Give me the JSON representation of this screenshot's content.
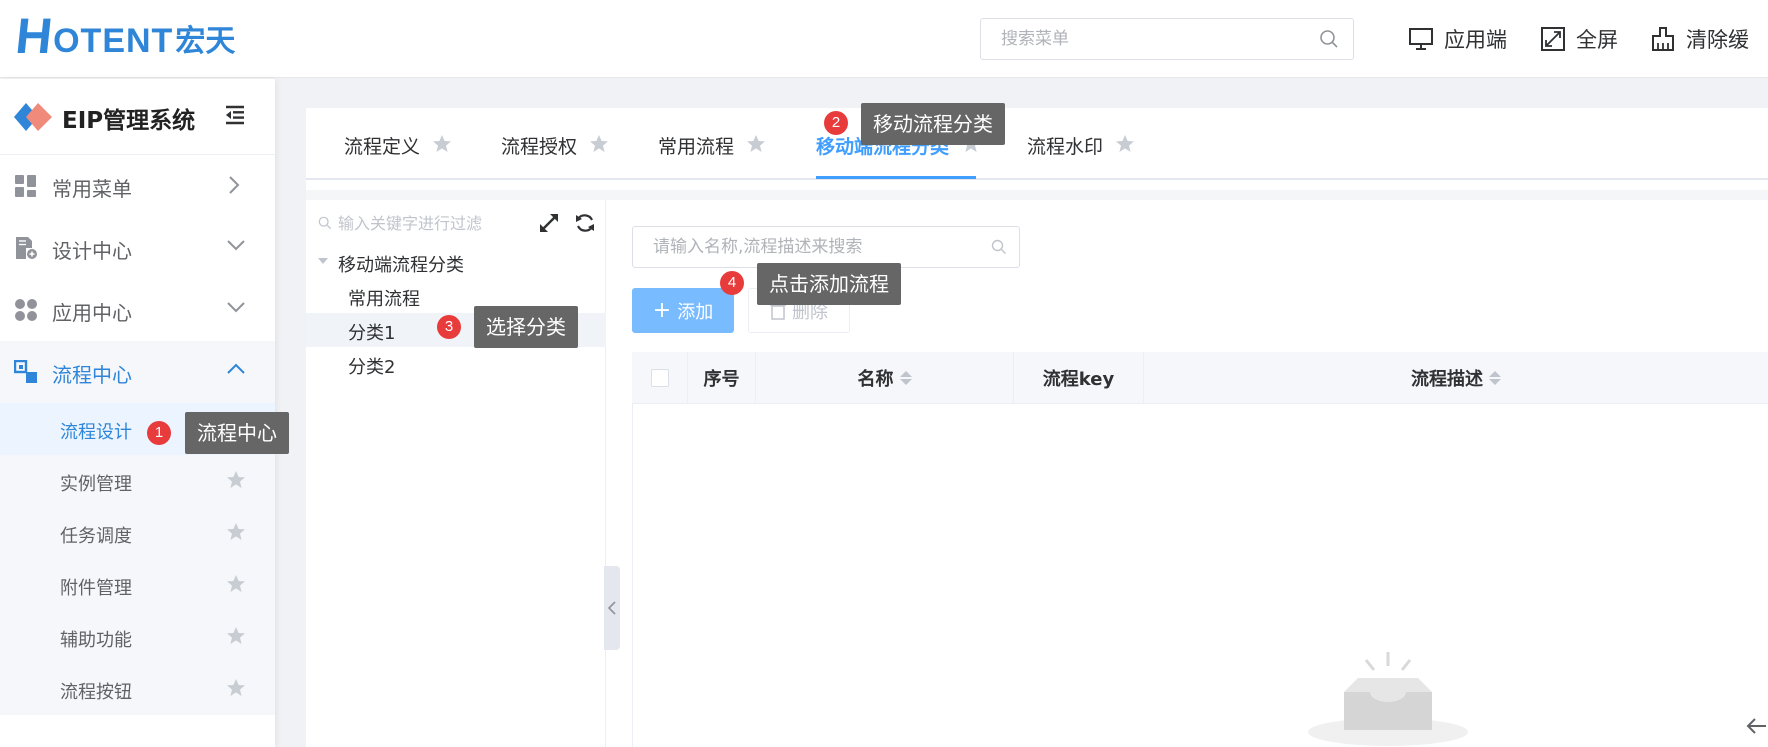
{
  "header": {
    "logo_h": "H",
    "logo_rest": "OTENT",
    "logo_cn": "宏天",
    "search_placeholder": "搜索菜单",
    "app_end_label": "应用端",
    "fullscreen_label": "全屏",
    "clear_cache_label": "清除缓"
  },
  "sidebar": {
    "system_name": "EIP管理系统",
    "menus": [
      {
        "label": "常用菜单",
        "icon": "grid-icon"
      },
      {
        "label": "设计中心",
        "icon": "document-settings-icon"
      },
      {
        "label": "应用中心",
        "icon": "apps-icon"
      },
      {
        "label": "流程中心",
        "icon": "flow-icon"
      }
    ],
    "sub_items": [
      {
        "label": "流程设计"
      },
      {
        "label": "实例管理"
      },
      {
        "label": "任务调度"
      },
      {
        "label": "附件管理"
      },
      {
        "label": "辅助功能"
      },
      {
        "label": "流程按钮"
      }
    ]
  },
  "tabs": [
    {
      "label": "流程定义"
    },
    {
      "label": "流程授权"
    },
    {
      "label": "常用流程"
    },
    {
      "label": "移动端流程分类"
    },
    {
      "label": "流程水印"
    }
  ],
  "tree": {
    "filter_placeholder": "输入关键字进行过滤",
    "root": "移动端流程分类",
    "children": [
      "常用流程",
      "分类1",
      "分类2"
    ]
  },
  "list": {
    "search_placeholder": "请输入名称,流程描述来搜索",
    "add_label": "添加",
    "delete_label": "删除",
    "columns": [
      "序号",
      "名称",
      "流程key",
      "流程描述"
    ]
  },
  "annotations": [
    {
      "number": "1",
      "text": "流程中心"
    },
    {
      "number": "2",
      "text": "移动流程分类"
    },
    {
      "number": "3",
      "text": "选择分类"
    },
    {
      "number": "4",
      "text": "点击添加流程"
    }
  ],
  "colors": {
    "brand": "#2f86d8",
    "primary": "#409eff",
    "badge": "#e83b3b",
    "tooltip": "#666666"
  }
}
